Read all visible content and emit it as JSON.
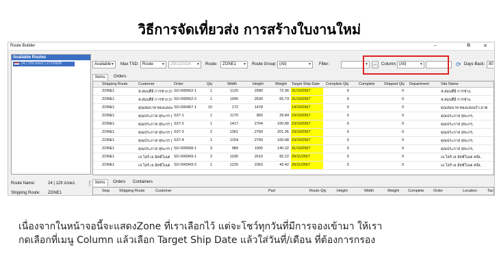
{
  "heading": "วิธีการจัดเที่ยวส่ง การสร้างใบงานใหม่",
  "app": {
    "title": "Route Builder",
    "min_icon": "–",
    "max_icon": "⧉",
    "close_icon": "✕"
  },
  "left": {
    "header": "Available Routes",
    "selected_route": "24 | 129 zone1 | 271/09/00",
    "route_name_label": "Route Name:",
    "route_name_value": "24 | 129 zone1",
    "shipping_route_label": "Shipping Route:",
    "shipping_route_value": "ZONE1",
    "splitter": "[ ]"
  },
  "toolbar": {
    "status_value": "Available",
    "max_tsd_label": "Max TSD:",
    "max_tsd_value": "Route",
    "date_value": "29/11/2024",
    "route_label": "Route:",
    "route_value": "ZONE1",
    "route_group_label": "Route Group:",
    "route_group_value": "(All)",
    "filter_label": "Filter:",
    "filter_value": "",
    "dots": "...",
    "column_label": "Column:",
    "column_value": "(All)",
    "search_value": "",
    "days_back_label": "Days Back:",
    "days_back_value": "80"
  },
  "tabs": [
    "Items",
    "Orders"
  ],
  "grid": {
    "columns": [
      "Shipping Route",
      "Customer",
      "Order",
      "Qty",
      "Width",
      "Height",
      "Weight",
      "Target Ship Date",
      "Complete Qty",
      "Complete",
      "Shipped Qty",
      "Department",
      "Site Name"
    ],
    "rows": [
      [
        "ZONE1",
        "ห.สมบติ์ย์ การช่าง (ก.",
        "SO-000562-1",
        "1",
        "1125",
        "2580",
        "72.36",
        "31/10/2567",
        "0",
        "",
        "0",
        "",
        "ห.สมบติ์ย์ การช่าง,"
      ],
      [
        "ZONE1",
        "ห.สมบติ์ย์ การช่าง (ก.",
        "SO-000562-2",
        "1",
        "1000",
        "2630",
        "65.73",
        "31/10/2567",
        "0",
        "",
        "0",
        "",
        "ห.สมบติ์ย์ การช่าง,"
      ],
      [
        "ZONE1",
        "คุณสมบาท ทองแสงแก้",
        "SO-000457-1",
        "10",
        "172",
        "1478",
        "",
        "14/10/2567",
        "0",
        "",
        "0",
        "",
        "คุณสมบาท ทองแสงแก้ว,ธาต"
      ],
      [
        "ZONE1",
        "คุณประภาส สุขะกร (",
        "S37-1",
        "1",
        "1170",
        "850",
        "29.84",
        "23/10/2567",
        "0",
        "",
        "0",
        "",
        "คุณประภาส สุขะกร,"
      ],
      [
        "ZONE1",
        "คุณประภาส สุขะกร (",
        "S37-2",
        "1",
        "1417",
        "2764",
        "100.68",
        "23/10/2567",
        "0",
        "",
        "0",
        "",
        "คุณประภาส สุขะกร,"
      ],
      [
        "ZONE1",
        "คุณประภาส สุขะกร (",
        "S37-3",
        "2",
        "1361",
        "2769",
        "201.36",
        "23/10/2567",
        "0",
        "",
        "0",
        "",
        "คุณประภาส สุขะกร,"
      ],
      [
        "ZONE1",
        "คุณประภาส สุขะกร (",
        "S37-4",
        "1",
        "1154",
        "2769",
        "100.68",
        "23/10/2567",
        "0",
        "",
        "0",
        "",
        "คุณประภาส สุขะกร,"
      ],
      [
        "ZONE1",
        "คุณประภาส สุขะกร (",
        "SO-000568-1",
        "3",
        "984",
        "1900",
        "140.22",
        "31/10/2567",
        "0",
        "",
        "0",
        "",
        "คุณประภาส สุขะกร,"
      ],
      [
        "ZONE1",
        "เจ โฮร์ เจ ฮัลซ์โบเต",
        "SO-000943-1",
        "2",
        "1030",
        "2610",
        "82.22",
        "29/11/2567",
        "0",
        "",
        "0",
        "",
        "เจ โฮร์ เจ ฮัลซ์โบเต หจั้ง,"
      ],
      [
        "ZONE1",
        "เจ โฮร์ เจ ฮัลซ์โบเต",
        "SO-000943-2",
        "1",
        "1225",
        "2363",
        "43.42",
        "29/11/2567",
        "0",
        "",
        "0",
        "",
        "เจ โฮร์ เจ ฮัลซ์โบเต หจั้ง,"
      ]
    ]
  },
  "bottom": {
    "tabs": [
      "Items",
      "Orders",
      "Containers"
    ],
    "columns": [
      "Stop",
      "Shipping Route",
      "Customer",
      "Part",
      "Route Qty",
      "Height",
      "Width",
      "Weight",
      "Complete",
      "Order",
      "Location",
      "Tac"
    ]
  },
  "caption": {
    "line1": "เนื่องจากในหน้าจอนี้จะแสดงZone ที่เราเลือกไว้ แต่จะโชว์ทุกวันที่มีการจองเข้ามา ให้เรา",
    "line2": "กดเลือกที่เมนู Column แล้วเลือก Target Ship Date แล้วใส่วันที่/เดือน ที่ต้องการกรอง"
  },
  "colors": {
    "highlight": "#ffff00",
    "annotation_box": "#e02020",
    "selection": "#3b6fc4"
  }
}
